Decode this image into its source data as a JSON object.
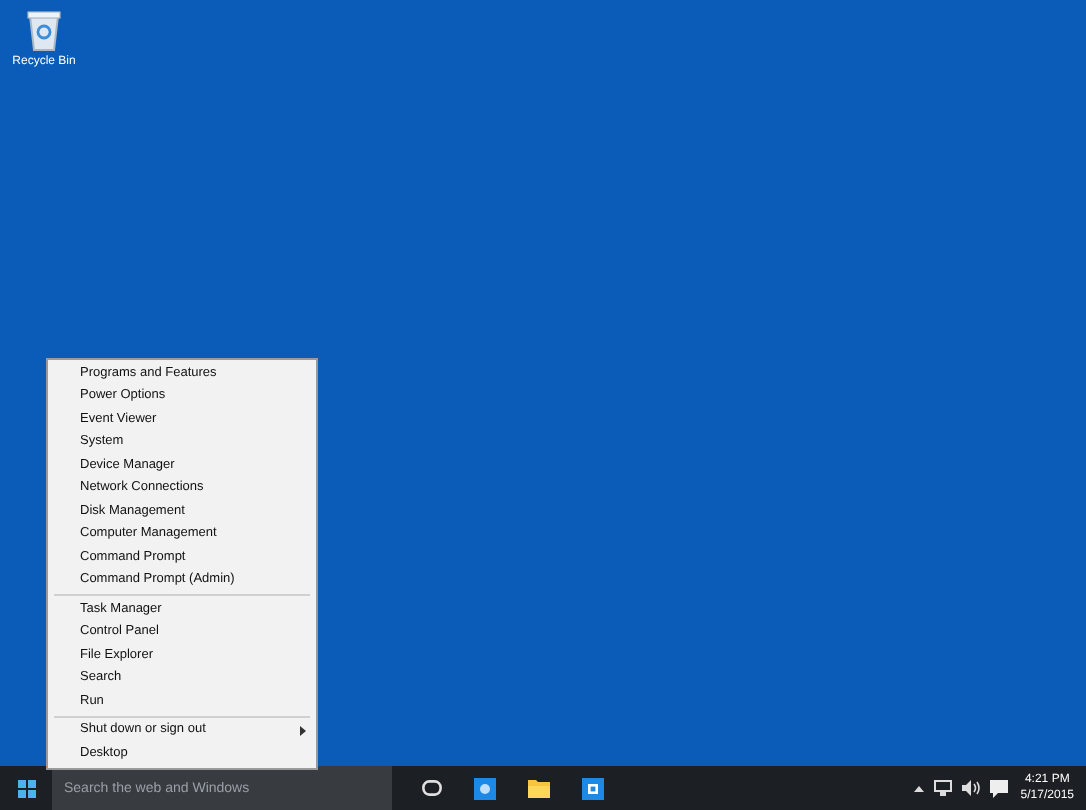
{
  "desktop_icons": [
    {
      "label": "Recycle Bin"
    }
  ],
  "context_menu": {
    "groups": [
      [
        {
          "label": "Programs and Features",
          "submenu": false
        },
        {
          "label": "Power Options",
          "submenu": false
        },
        {
          "label": "Event Viewer",
          "submenu": false
        },
        {
          "label": "System",
          "submenu": false
        },
        {
          "label": "Device Manager",
          "submenu": false
        },
        {
          "label": "Network Connections",
          "submenu": false
        },
        {
          "label": "Disk Management",
          "submenu": false
        },
        {
          "label": "Computer Management",
          "submenu": false
        },
        {
          "label": "Command Prompt",
          "submenu": false
        },
        {
          "label": "Command Prompt (Admin)",
          "submenu": false
        }
      ],
      [
        {
          "label": "Task Manager",
          "submenu": false
        },
        {
          "label": "Control Panel",
          "submenu": false
        },
        {
          "label": "File Explorer",
          "submenu": false
        },
        {
          "label": "Search",
          "submenu": false
        },
        {
          "label": "Run",
          "submenu": false
        }
      ],
      [
        {
          "label": "Shut down or sign out",
          "submenu": true
        },
        {
          "label": "Desktop",
          "submenu": false
        }
      ]
    ]
  },
  "taskbar": {
    "search": {
      "placeholder": "Search the web and Windows"
    },
    "apps": [
      {
        "kind": "task-view"
      },
      {
        "kind": "blue-app"
      },
      {
        "kind": "folder"
      },
      {
        "kind": "store"
      }
    ],
    "clock": {
      "time": "4:21 PM",
      "date": "5/17/2015"
    }
  }
}
